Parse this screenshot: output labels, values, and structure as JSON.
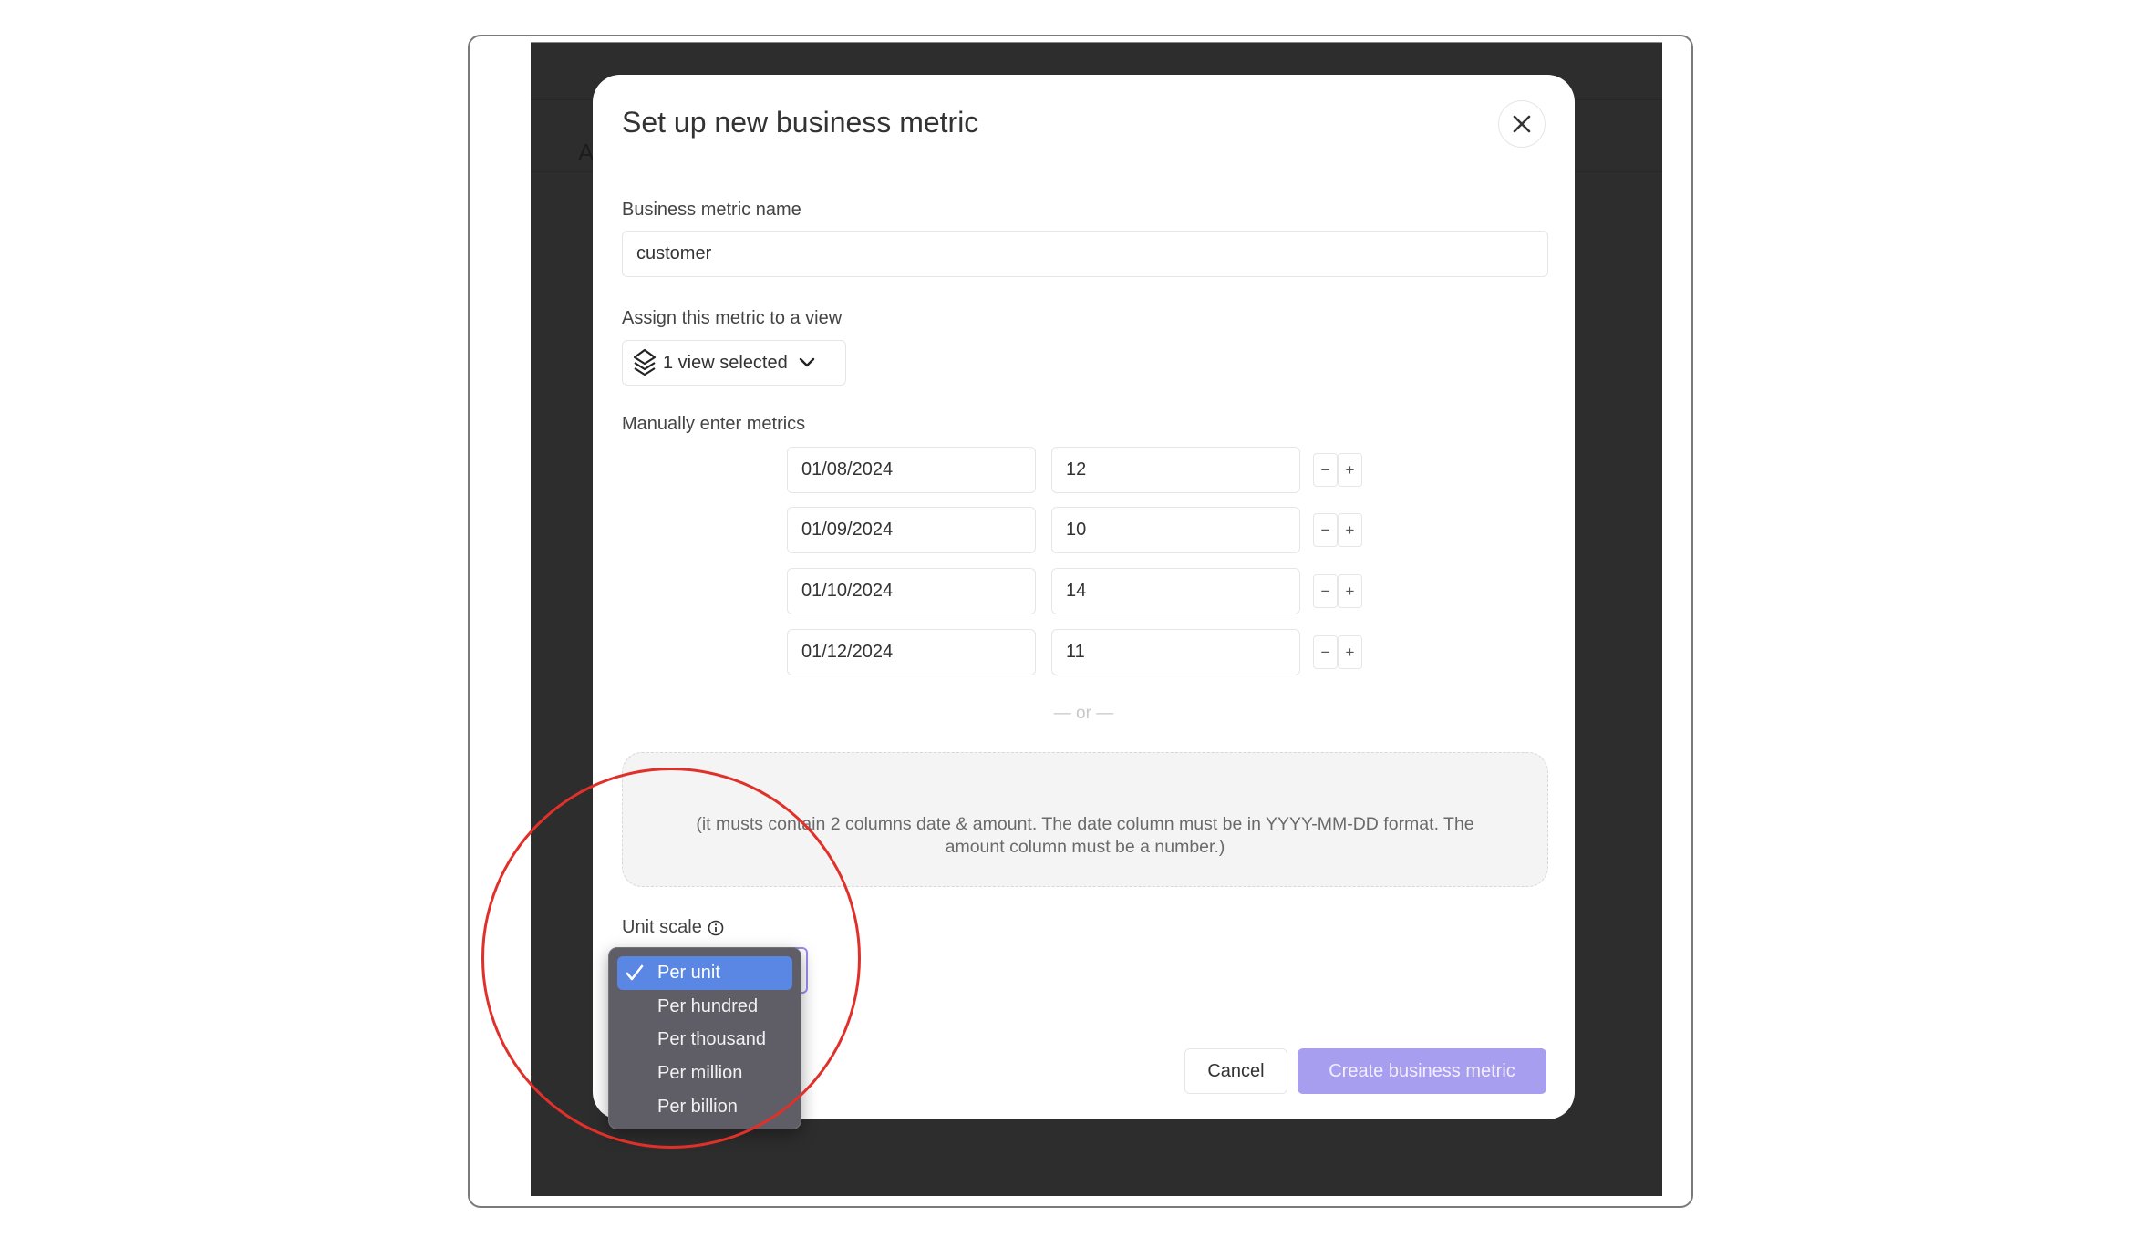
{
  "background_app": {
    "partial_letter": "A"
  },
  "modal": {
    "title": "Set up new business metric",
    "close_icon": "close-icon",
    "name_field": {
      "label": "Business metric name",
      "value": "customer"
    },
    "view_field": {
      "label": "Assign this metric to a view",
      "value": "1 view selected",
      "icon": "layers-icon"
    },
    "metrics": {
      "label": "Manually enter metrics",
      "rows": [
        {
          "date": "01/08/2024",
          "value": "12"
        },
        {
          "date": "01/09/2024",
          "value": "10"
        },
        {
          "date": "01/10/2024",
          "value": "14"
        },
        {
          "date": "01/12/2024",
          "value": "11"
        }
      ],
      "minus_label": "−",
      "plus_label": "+"
    },
    "separator": "— or —",
    "dropzone": {
      "text": "(it musts contain 2 columns date & amount. The date column must be in YYYY-MM-DD format. The amount column must be a number.)"
    },
    "unit_scale": {
      "label": "Unit scale",
      "info_icon": "info-icon",
      "selected": "Per unit",
      "options": [
        "Per unit",
        "Per hundred",
        "Per thousand",
        "Per million",
        "Per billion"
      ]
    },
    "buttons": {
      "cancel": "Cancel",
      "create": "Create business metric"
    }
  },
  "colors": {
    "accent": "#a89eef",
    "dropdown_highlight": "#5a86e4",
    "annotation": "#e0302a",
    "overlay_bg": "#2d2d2d"
  }
}
